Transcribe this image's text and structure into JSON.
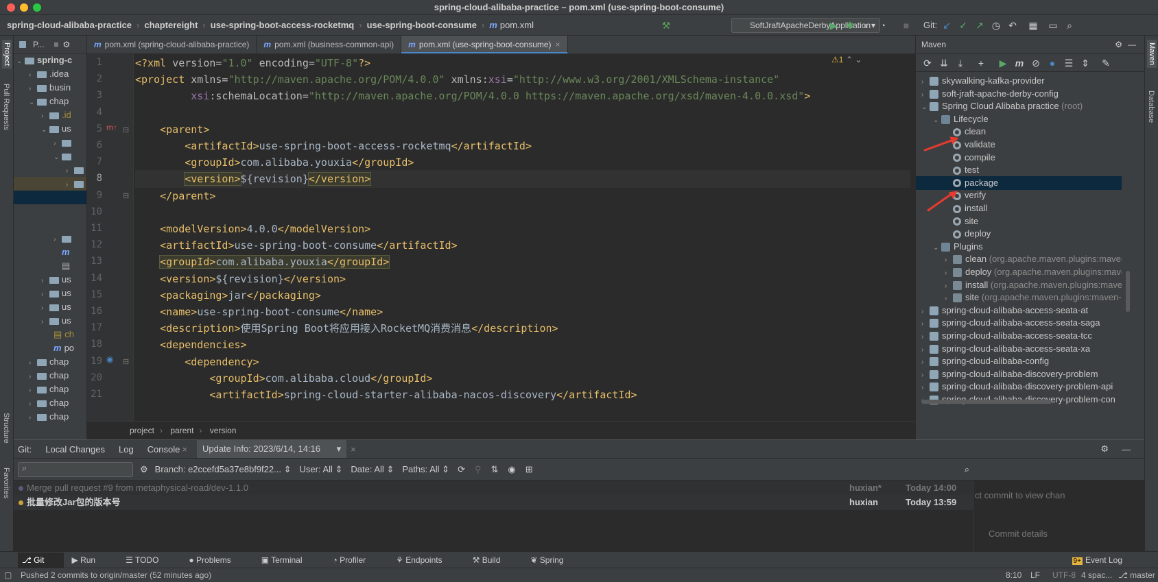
{
  "window_title": "spring-cloud-alibaba-practice – pom.xml (use-spring-boot-consume)",
  "breadcrumbs": [
    "spring-cloud-alibaba-practice",
    "chaptereight",
    "use-spring-boot-access-rocketmq",
    "use-spring-boot-consume",
    "pom.xml"
  ],
  "run_config": "SoftJraftApacheDerbyApplication",
  "git_label": "Git:",
  "left_strip": [
    "Project",
    "Pull Requests",
    "Structure",
    "Favorites"
  ],
  "right_strip": [
    "Maven",
    "Database"
  ],
  "project": {
    "title": "P...",
    "rows": [
      ".idea",
      "busin",
      "chap",
      ".id",
      "us",
      "us",
      "us",
      "us",
      "us",
      "ch",
      "po",
      "chap",
      "chap",
      "chap",
      "chap",
      "chap"
    ],
    "root": "spring-c"
  },
  "tabs": [
    {
      "label": "pom.xml (spring-cloud-alibaba-practice)",
      "active": false
    },
    {
      "label": "pom.xml (business-common-api)",
      "active": false
    },
    {
      "label": "pom.xml (use-spring-boot-consume)",
      "active": true
    }
  ],
  "warnings": "⚠1",
  "code_lines": [
    {
      "n": "1",
      "html": "<span class='t'>&lt;?xml </span><span class='a'>version=</span><span class='s'>\"1.0\"</span><span class='a'> encoding=</span><span class='s'>\"UTF-8\"</span><span class='t'>?&gt;</span>"
    },
    {
      "n": "2",
      "html": "<span class='t'>&lt;project </span><span class='a'>xmlns=</span><span class='s'>\"http://maven.apache.org/POM/4.0.0\"</span><span class='a'> xmlns:</span><span class='ns'>xsi</span><span class='a'>=</span><span class='s'>\"http://www.w3.org/2001/XMLSchema-instance\"</span>"
    },
    {
      "n": "3",
      "html": "<span class='ns'>         xsi</span><span class='a'>:schemaLocation=</span><span class='s'>\"http://maven.apache.org/POM/4.0.0 https://maven.apache.org/xsd/maven-4.0.0.xsd\"</span><span class='t'>&gt;</span>"
    },
    {
      "n": "4",
      "html": ""
    },
    {
      "n": "5",
      "html": "    <span class='t'>&lt;parent&gt;</span>"
    },
    {
      "n": "6",
      "html": "        <span class='t'>&lt;artifactId&gt;</span>use-spring-boot-access-rocketmq<span class='t'>&lt;/artifactId&gt;</span>"
    },
    {
      "n": "7",
      "html": "        <span class='t'>&lt;groupId&gt;</span>com.alibaba.youxia<span class='t'>&lt;/groupId&gt;</span>"
    },
    {
      "n": "8",
      "html": "        <span class='t hl'>&lt;version&gt;</span>${revision}<span class='t hl'>&lt;/version&gt;</span>"
    },
    {
      "n": "9",
      "html": "    <span class='t'>&lt;/parent&gt;</span>"
    },
    {
      "n": "10",
      "html": ""
    },
    {
      "n": "11",
      "html": "    <span class='t'>&lt;modelVersion&gt;</span>4.0.0<span class='t'>&lt;/modelVersion&gt;</span>"
    },
    {
      "n": "12",
      "html": "    <span class='t'>&lt;artifactId&gt;</span>use-spring-boot-consume<span class='t'>&lt;/artifactId&gt;</span>"
    },
    {
      "n": "13",
      "html": "    <span class='hl'><span class='t'>&lt;groupId&gt;</span>com.alibaba.youxia<span class='t'>&lt;/groupId&gt;</span></span>"
    },
    {
      "n": "14",
      "html": "    <span class='t'>&lt;version&gt;</span>${revision}<span class='t'>&lt;/version&gt;</span>"
    },
    {
      "n": "15",
      "html": "    <span class='t'>&lt;packaging&gt;</span>jar<span class='t'>&lt;/packaging&gt;</span>"
    },
    {
      "n": "16",
      "html": "    <span class='t'>&lt;name&gt;</span>use-spring-boot-consume<span class='t'>&lt;/name&gt;</span>"
    },
    {
      "n": "17",
      "html": "    <span class='t'>&lt;description&gt;</span>使用Spring Boot将应用接入RocketMQ消费消息<span class='t'>&lt;/description&gt;</span>"
    },
    {
      "n": "18",
      "html": "    <span class='t'>&lt;dependencies&gt;</span>"
    },
    {
      "n": "19",
      "html": "        <span class='t'>&lt;dependency&gt;</span>"
    },
    {
      "n": "20",
      "html": "            <span class='t'>&lt;groupId&gt;</span>com.alibaba.cloud<span class='t'>&lt;/groupId&gt;</span>"
    },
    {
      "n": "21",
      "html": "            <span class='t'>&lt;artifactId&gt;</span>spring-cloud-starter-alibaba-nacos-discovery<span class='t'>&lt;/artifactId&gt;</span>"
    }
  ],
  "editor_breadcrumb": [
    "project",
    "parent",
    "version"
  ],
  "maven": {
    "title": "Maven",
    "rows": [
      {
        "label": "skywalking-kafka-provider",
        "dim": "",
        "kind": "module",
        "level": 0,
        "arrow": "›"
      },
      {
        "label": "soft-jraft-apache-derby-config",
        "dim": "",
        "kind": "module",
        "level": 0,
        "arrow": "›"
      },
      {
        "label": "Spring Cloud Alibaba practice",
        "dim": " (root)",
        "kind": "module",
        "level": 0,
        "arrow": "⌄"
      },
      {
        "label": "Lifecycle",
        "dim": "",
        "kind": "folder",
        "level": 1,
        "arrow": "⌄"
      },
      {
        "label": "clean",
        "dim": "",
        "kind": "gear",
        "level": 2,
        "arrow": ""
      },
      {
        "label": "validate",
        "dim": "",
        "kind": "gear",
        "level": 2,
        "arrow": ""
      },
      {
        "label": "compile",
        "dim": "",
        "kind": "gear",
        "level": 2,
        "arrow": ""
      },
      {
        "label": "test",
        "dim": "",
        "kind": "gear",
        "level": 2,
        "arrow": ""
      },
      {
        "label": "package",
        "dim": "",
        "kind": "gear",
        "level": 2,
        "arrow": "",
        "selected": true
      },
      {
        "label": "verify",
        "dim": "",
        "kind": "gear",
        "level": 2,
        "arrow": ""
      },
      {
        "label": "install",
        "dim": "",
        "kind": "gear",
        "level": 2,
        "arrow": ""
      },
      {
        "label": "site",
        "dim": "",
        "kind": "gear",
        "level": 2,
        "arrow": ""
      },
      {
        "label": "deploy",
        "dim": "",
        "kind": "gear",
        "level": 2,
        "arrow": ""
      },
      {
        "label": "Plugins",
        "dim": "",
        "kind": "folder",
        "level": 1,
        "arrow": "⌄"
      },
      {
        "label": "clean",
        "dim": " (org.apache.maven.plugins:maven",
        "kind": "plugin",
        "level": 2,
        "arrow": "›"
      },
      {
        "label": "deploy",
        "dim": " (org.apache.maven.plugins:mave",
        "kind": "plugin",
        "level": 2,
        "arrow": "›"
      },
      {
        "label": "install",
        "dim": " (org.apache.maven.plugins:maven",
        "kind": "plugin",
        "level": 2,
        "arrow": "›"
      },
      {
        "label": "site",
        "dim": " (org.apache.maven.plugins:maven-s",
        "kind": "plugin",
        "level": 2,
        "arrow": "›"
      },
      {
        "label": "spring-cloud-alibaba-access-seata-at",
        "dim": "",
        "kind": "module",
        "level": 0,
        "arrow": "›"
      },
      {
        "label": "spring-cloud-alibaba-access-seata-saga",
        "dim": "",
        "kind": "module",
        "level": 0,
        "arrow": "›"
      },
      {
        "label": "spring-cloud-alibaba-access-seata-tcc",
        "dim": "",
        "kind": "module",
        "level": 0,
        "arrow": "›"
      },
      {
        "label": "spring-cloud-alibaba-access-seata-xa",
        "dim": "",
        "kind": "module",
        "level": 0,
        "arrow": "›"
      },
      {
        "label": "spring-cloud-alibaba-config",
        "dim": "",
        "kind": "module",
        "level": 0,
        "arrow": "›"
      },
      {
        "label": "spring-cloud-alibaba-discovery-problem",
        "dim": "",
        "kind": "module",
        "level": 0,
        "arrow": "›"
      },
      {
        "label": "spring-cloud-alibaba-discovery-problem-api",
        "dim": "",
        "kind": "module",
        "level": 0,
        "arrow": "›"
      },
      {
        "label": "spring-cloud-alibaba-discovery-problem-con",
        "dim": "",
        "kind": "module",
        "level": 0,
        "arrow": "›"
      }
    ]
  },
  "git": {
    "tabs": [
      "Git:",
      "Local Changes",
      "Log",
      "Console",
      "Update Info: 2023/6/14, 14:16"
    ],
    "branch": "Branch: e2ccefd5a37e8bf9f22...",
    "user": "User: All",
    "date": "Date: All",
    "paths": "Paths: All",
    "commits": [
      {
        "msg": "Merge pull request #9 from metaphysical-road/dev-1.1.0",
        "author": "huxian*",
        "time": "Today 14:00",
        "dim": true
      },
      {
        "msg": "批量修改Jar包的版本号",
        "author": "huxian",
        "time": "Today 13:59",
        "dim": false
      }
    ],
    "side_text": "ct commit to view chan",
    "commit_details": "Commit details"
  },
  "bottom_tabs": [
    "Git",
    "Run",
    "TODO",
    "Problems",
    "Terminal",
    "Profiler",
    "Endpoints",
    "Build",
    "Spring"
  ],
  "event_log": "Event Log",
  "status": {
    "message": "Pushed 2 commits to origin/master (52 minutes ago)",
    "position": "8:10",
    "line_sep": "LF",
    "encoding": "UTF-8",
    "indent": "4 spac...",
    "branch": "master"
  },
  "colors": {
    "accent": "#4a88c7",
    "selection": "#0d293e",
    "tag": "#e8bf6a",
    "string": "#6a8759",
    "arrow": "#e63b2e"
  }
}
